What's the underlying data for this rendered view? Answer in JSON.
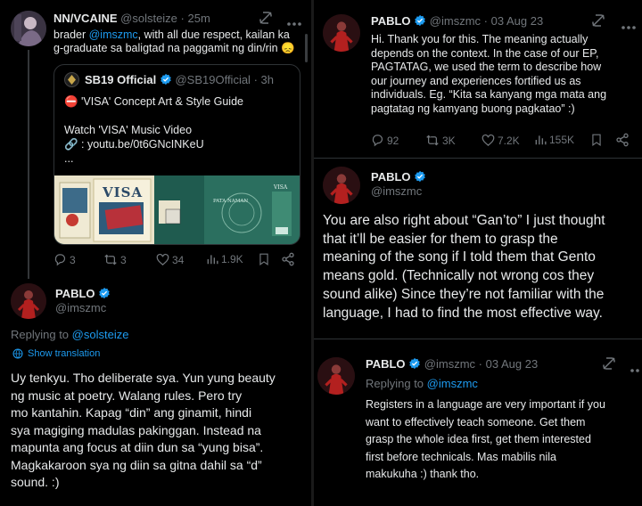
{
  "left": {
    "top_tweet": {
      "name": "NN/VCAINE",
      "handle": "@solsteize",
      "dot": "·",
      "time": "25m",
      "text_prefix": "brader ",
      "mention": "@imszmc",
      "text_line1_rest": ", with all due respect, kailan ka",
      "text_line2": "g-graduate sa baligtad na paggamit ng din/rin 😞",
      "quote": {
        "name": "SB19 Official",
        "handle": "@SB19Official",
        "dot": "·",
        "time": "3h",
        "line1": "⛔ 'VISA' Concept Art & Style Guide",
        "line2": "Watch 'VISA' Music Video",
        "line3": "🔗 : youtu.be/0t6GNcINKeU",
        "line4": "...",
        "poster_visa": "VISA",
        "poster_brand": "VISA",
        "poster_small": "PATA NAMAN"
      },
      "metrics": {
        "replies": "3",
        "retweets": "3",
        "likes": "34",
        "views": "1.9K"
      }
    },
    "reply": {
      "name": "PABLO",
      "handle": "@imszmc",
      "replying_label": "Replying to ",
      "replying_to": "@solsteize",
      "show_translation": "Show translation",
      "lines": [
        "Uy tenkyu. Tho deliberate sya. Yun yung beauty",
        "ng music at poetry. Walang rules. Pero try",
        "mo kantahin. Kapag “din” ang ginamit, hindi",
        "sya magiging madulas pakinggan. Instead na",
        "mapunta ang focus at diin dun sa “yung bisa”.",
        "Magkakaroon sya ng diin sa gitna dahil sa “d”",
        "sound. :)"
      ]
    }
  },
  "right": {
    "t1": {
      "name": "PABLO",
      "handle": "@imszmc",
      "dot": "·",
      "time": "03 Aug 23",
      "lines": [
        "Hi. Thank you for this. The meaning actually",
        "depends on the context. In the case of our EP,",
        "PAGTATAG, we used the term to describe how",
        "our journey and experiences fortified us as",
        "individuals. Eg. “Kita sa kanyang mga mata ang",
        "pagtatag ng kamyang buong pagkatao” :)"
      ],
      "metrics": {
        "replies": "92",
        "retweets": "3K",
        "likes": "7.2K",
        "views": "155K"
      }
    },
    "t2": {
      "name": "PABLO",
      "handle": "@imszmc",
      "lines": [
        "You are also right about “Gan’to” I just thought",
        "that it’ll be easier for them to grasp the",
        "meaning of the song if I told them that Gento",
        "means gold. (Technically not wrong cos they",
        "sound alike) Since they’re not familiar with the",
        "language, I had to find the most effective way."
      ]
    },
    "t3": {
      "name": "PABLO",
      "handle": "@imszmc",
      "dot": "·",
      "time": "03 Aug 23",
      "replying_label": "Replying to ",
      "replying_to": "@imszmc",
      "lines": [
        "Registers in a language are very important if you",
        "want to effectively teach someone. Get them",
        "grasp the whole idea first, get them interested",
        "first before technicals. Mas mabilis nila",
        "makukuha :) thank tho."
      ]
    }
  },
  "colors": {
    "background": "#000000",
    "text": "#e7e9ea",
    "muted": "#71767b",
    "accent": "#1d9bf0",
    "border": "#2f3336"
  },
  "icons": [
    "grok-icon",
    "more-icon",
    "verified-icon",
    "reply-icon",
    "retweet-icon",
    "like-icon",
    "views-icon",
    "bookmark-icon",
    "share-icon",
    "translate-icon"
  ]
}
